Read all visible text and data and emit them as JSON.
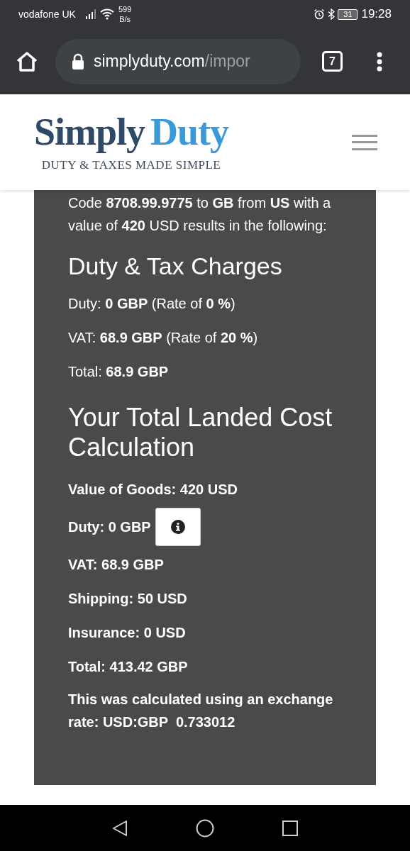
{
  "status_bar": {
    "carrier": "vodafone UK",
    "speed_value": "599",
    "speed_unit": "B/s",
    "battery": "31",
    "time": "19:28"
  },
  "browser": {
    "url_host": "simplyduty.com",
    "url_path": "/impor",
    "tab_count": "7"
  },
  "header": {
    "logo_first": "Simply",
    "logo_second": "Duty",
    "tagline": "DUTY & TAXES MADE SIMPLE"
  },
  "result": {
    "intro": "Code **8708.99.9775** to **GB** from **US** with a value of **420** USD results in the following:",
    "charges_title": "Duty & Tax Charges",
    "charges": [
      "Duty: **0 GBP** (Rate of **0 %**)",
      "VAT: **68.9 GBP** (Rate of **20 %**)",
      "Total: **68.9 GBP**"
    ],
    "landed_title": "Your Total Landed Cost Calculation",
    "landed": [
      {
        "text": "Value of Goods: 420 USD",
        "kind": "plain"
      },
      {
        "text": "Duty: 0 GBP",
        "kind": "info"
      },
      {
        "text": "VAT: 68.9 GBP",
        "kind": "plain"
      },
      {
        "text": "Shipping: 50 USD",
        "kind": "plain"
      },
      {
        "text": "Insurance: 0 USD",
        "kind": "plain"
      },
      {
        "text": "Total: 413.42 GBP",
        "kind": "plain"
      }
    ],
    "note": "This was calculated using an exchange rate: USD:GBP  0.733012"
  }
}
